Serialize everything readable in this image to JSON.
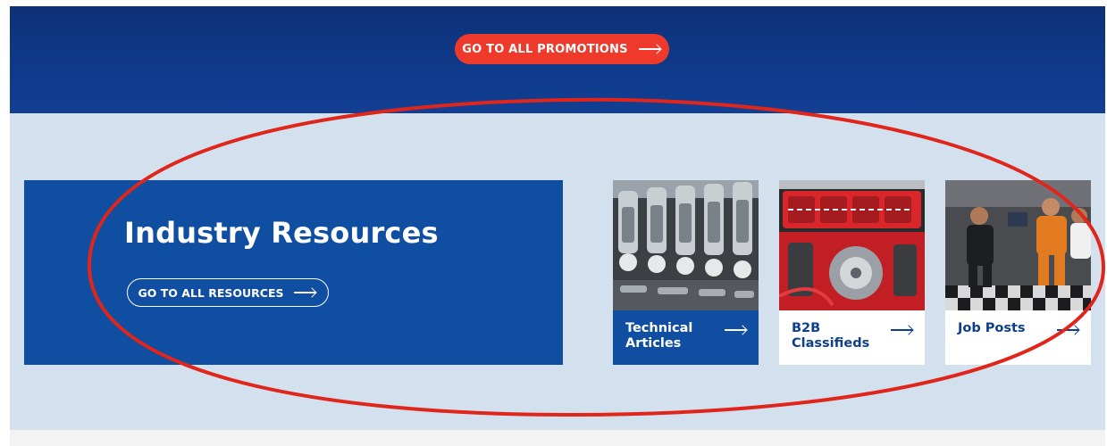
{
  "promotions": {
    "button_label": "GO TO ALL PROMOTIONS",
    "button_color": "#ef3a2b",
    "band_color": "#0f3a8a"
  },
  "resources": {
    "title": "Industry Resources",
    "button_label": "GO TO ALL RESOURCES",
    "band_color": "#d3e1ef",
    "feature_color": "#0f4ea0"
  },
  "cards": [
    {
      "label": "Technical Articles",
      "image": "engine-valvetrain-photo",
      "icon": "arrow-right-icon"
    },
    {
      "label": "B2B Classifieds",
      "image": "red-engine-intake-photo",
      "icon": "arrow-right-icon"
    },
    {
      "label": "Job Posts",
      "image": "workers-in-shop-photo",
      "icon": "arrow-right-icon"
    }
  ],
  "annotation": {
    "shape": "ellipse",
    "color": "#e0251b"
  }
}
